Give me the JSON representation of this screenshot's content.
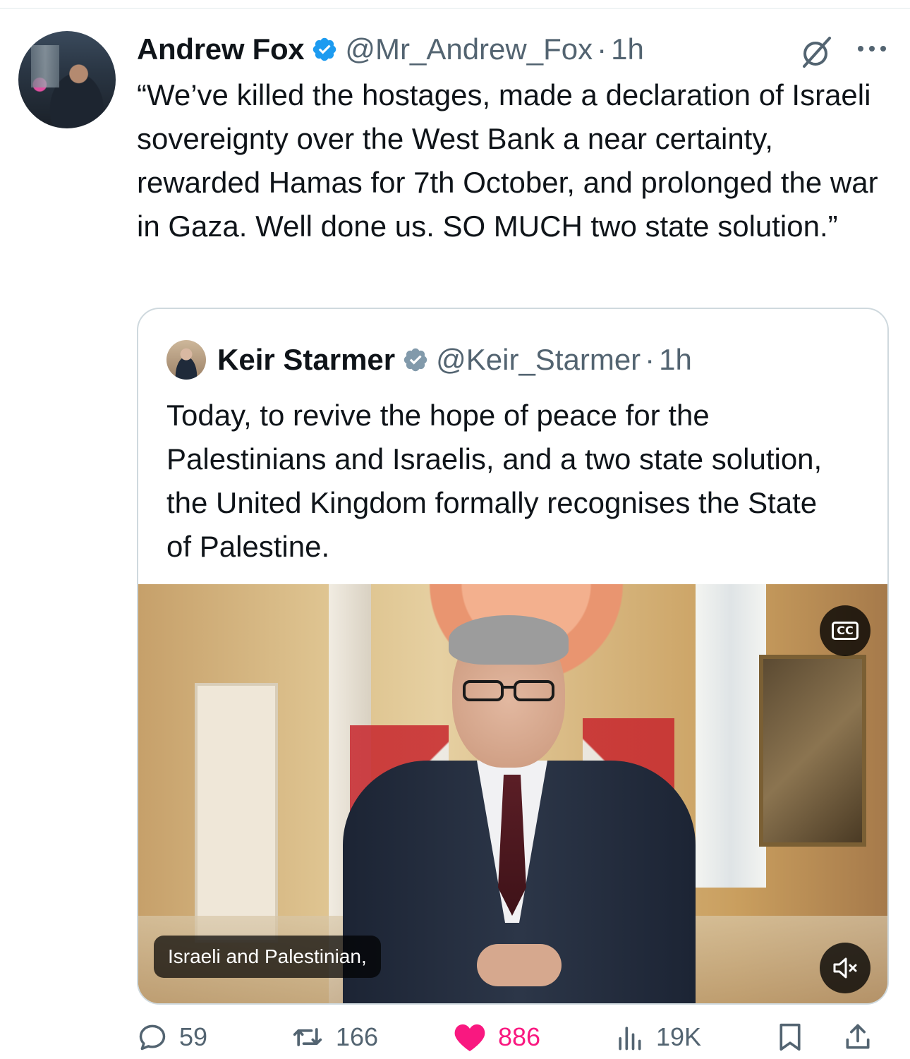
{
  "tweet": {
    "author_name": "Andrew Fox",
    "handle": "@Mr_Andrew_Fox",
    "separator": "·",
    "time": "1h",
    "text": "“We’ve killed the hostages, made a declaration of Israeli sovereignty over the West Bank a near certainty, rewarded Hamas for 7th October, and prolonged the war in Gaza. Well done us. SO MUCH two state solution.”"
  },
  "quote": {
    "author_name": "Keir Starmer",
    "handle": "@Keir_Starmer",
    "separator": "·",
    "time": "1h",
    "text": "Today, to revive the hope of peace for the Palestinians and Israelis, and a two state solution, the United Kingdom formally recognises the State of Palestine.",
    "video": {
      "caption": "Israeli and Palestinian,",
      "cc_label": "CC",
      "muted": true
    }
  },
  "actions": {
    "replies": "59",
    "reposts": "166",
    "likes": "886",
    "views": "19K",
    "liked": true
  },
  "colors": {
    "verified_blue": "#1d9bf0",
    "quote_verified_gray": "#829aab",
    "like_pink": "#f91880",
    "secondary_text": "#536471",
    "border": "#cfd9de"
  },
  "icons": {
    "verified": "verified-badge-icon",
    "grok": "grok-icon",
    "more": "more-icon",
    "reply": "reply-icon",
    "repost": "repost-icon",
    "like": "heart-icon",
    "views": "views-icon",
    "bookmark": "bookmark-icon",
    "share": "share-icon",
    "cc": "closed-captions-icon",
    "mute": "speaker-muted-icon"
  }
}
